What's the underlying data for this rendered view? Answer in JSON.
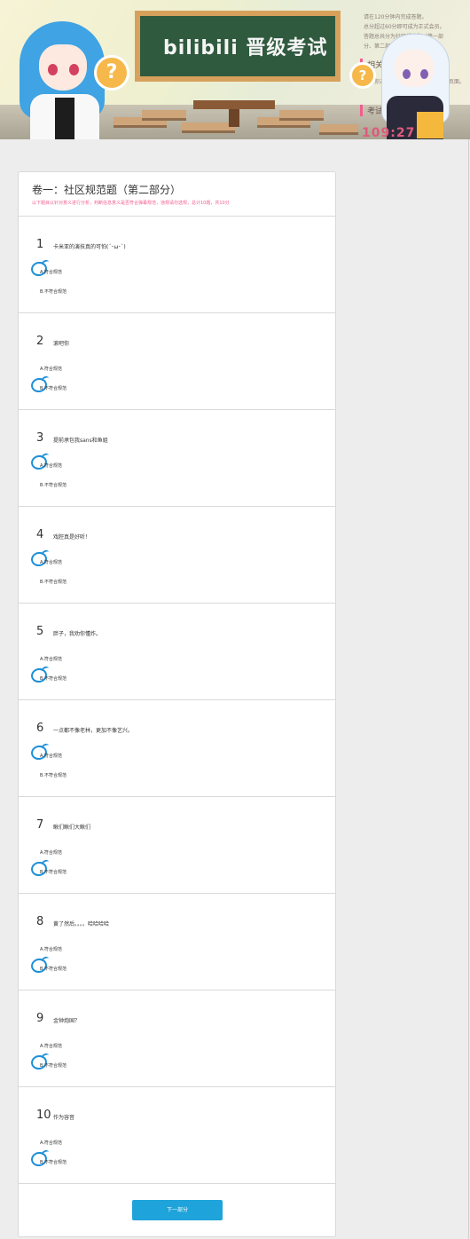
{
  "banner": {
    "chalkboard_title": "bilibili 晋级考试",
    "question_mark": "?",
    "side_panel": {
      "lines": [
        "请在120分钟内完成答题。",
        "总分超过60分即可成为正式会员。",
        "答题总共分为社区规范题（第一部",
        "分、第二部分）和自选题。"
      ],
      "heading_help": "相关帮助",
      "help_text": "如果你对答题有疑问，可以查看帮助页面。",
      "heading_status": "考试剩余时间",
      "counter": "109:27"
    }
  },
  "paper": {
    "title": "卷一：社区规范题（第二部分）",
    "description": "以下题目以针对意义进行分析，判断信息意义是否符合弹幕规范，违规请勿选规，总计10题，共10分",
    "option_a": "A.符合规范",
    "option_b": "B.不符合规范",
    "questions": [
      {
        "num": "1",
        "text": "卡米亚的演技真的可怕(´･ω･`)",
        "selected": "A"
      },
      {
        "num": "2",
        "text": "滚吧你",
        "selected": "B"
      },
      {
        "num": "3",
        "text": "提前承包我sans和鱼姐",
        "selected": "A"
      },
      {
        "num": "4",
        "text": "戏腔真是好听！",
        "selected": "A"
      },
      {
        "num": "5",
        "text": "胖子，我劝你懂炸。",
        "selected": "B"
      },
      {
        "num": "6",
        "text": "一点都不像老林，更加不像艺兴。",
        "selected": "A"
      },
      {
        "num": "7",
        "text": "瞅们瞅们大瞅们",
        "selected": "B"
      },
      {
        "num": "8",
        "text": "黄了然后。。。。哈哈哈哈",
        "selected": "B"
      },
      {
        "num": "9",
        "text": "金钟炮国？",
        "selected": "B"
      },
      {
        "num": "10",
        "text": "作为容音",
        "selected": "B"
      }
    ],
    "next_button": "下一部分"
  },
  "colors": {
    "accent_blue": "#1ea3da",
    "accent_pink": "#f25d8e",
    "mark_blue": "#1d8fd8"
  }
}
